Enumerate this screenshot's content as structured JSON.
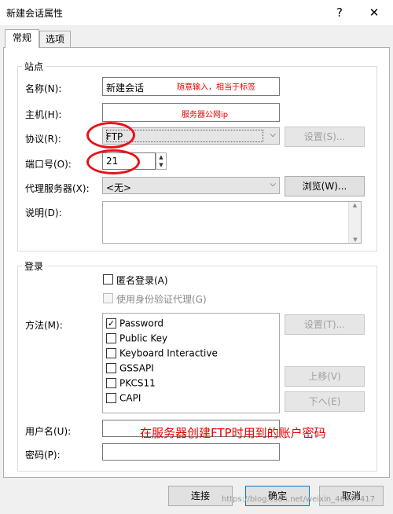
{
  "window": {
    "title": "新建会话属性",
    "help_glyph": "?",
    "close_glyph": "✕"
  },
  "tabs": [
    {
      "label": "常规"
    },
    {
      "label": "选项"
    }
  ],
  "site": {
    "group_title": "站点",
    "name_label": "名称(N):",
    "name_value": "新建会话",
    "name_annotation": "随意输入，相当于标签",
    "host_label": "主机(H):",
    "host_annotation": "服务器公网ip",
    "protocol_label": "协议(R):",
    "protocol_value": "FTP",
    "settings_button": "设置(S)...",
    "port_label": "端口号(O):",
    "port_value": "21",
    "proxy_label": "代理服务器(X):",
    "proxy_value": "<无>",
    "browse_button": "浏览(W)...",
    "desc_label": "说明(D):"
  },
  "login": {
    "group_title": "登录",
    "anonymous_label": "匿名登录(A)",
    "agent_label": "使用身份验证代理(G)",
    "method_label": "方法(M):",
    "methods": [
      {
        "label": "Password",
        "checked": true
      },
      {
        "label": "Public Key",
        "checked": false
      },
      {
        "label": "Keyboard Interactive",
        "checked": false
      },
      {
        "label": "GSSAPI",
        "checked": false
      },
      {
        "label": "PKCS11",
        "checked": false
      },
      {
        "label": "CAPI",
        "checked": false
      }
    ],
    "method_settings_button": "设置(T)...",
    "move_up_button": "上移(V)",
    "move_down_button": "下へ(E)",
    "username_label": "用户名(U):",
    "account_annotation": "在服务器创建FTP时用到的账户密码",
    "password_label": "密码(P):"
  },
  "footer": {
    "connect_button": "连接",
    "ok_button": "确定",
    "cancel_button": "取消",
    "watermark": "https://blog.csdn.net/weixin_46357417"
  },
  "colors": {
    "annotation_red": "#e60000",
    "ellipse_red": "#e8121a"
  }
}
